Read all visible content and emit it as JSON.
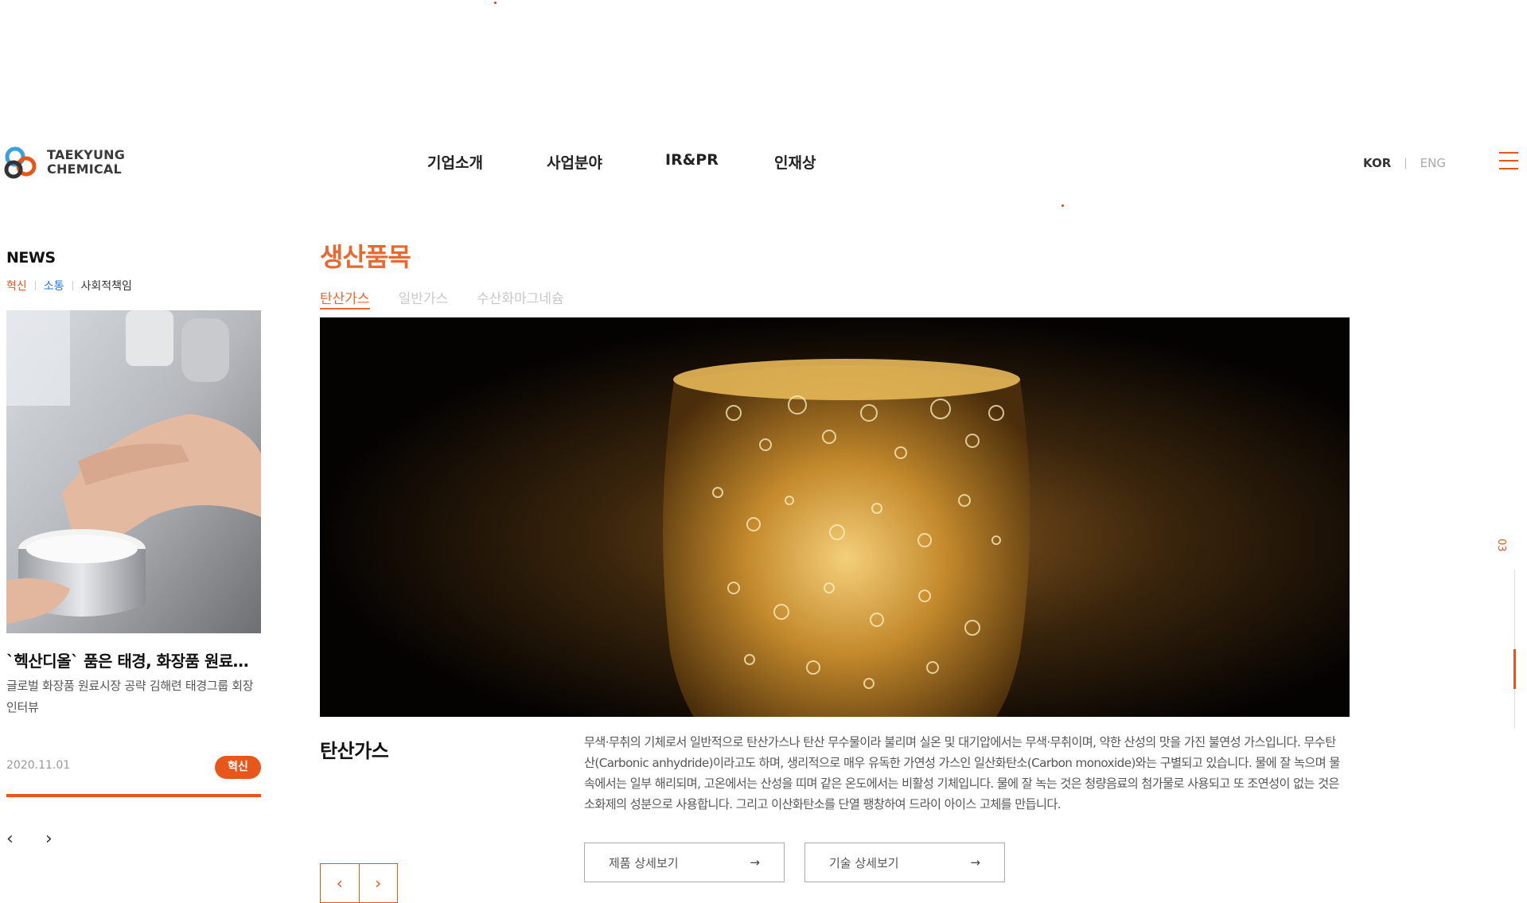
{
  "header": {
    "logo": {
      "line1": "TAEKYUNG",
      "line2": "CHEMICAL"
    },
    "nav": [
      "기업소개",
      "사업분야",
      "IR&PR",
      "인재상"
    ],
    "lang": {
      "kor": "KOR",
      "separator": "|",
      "eng": "ENG"
    },
    "menu_icon": "hamburger-icon"
  },
  "news": {
    "title": "NEWS",
    "tabs": [
      "혁신",
      "소통",
      "사회적책임"
    ],
    "headline": "`헥산디올` 품은 태경, 화장품 원료시장 공략",
    "description": "글로벌 화장품 원료시장 공략 김해련 태경그룹 회장 인터뷰",
    "date": "2020.11.01",
    "badge": "혁신",
    "prev_icon": "chevron-left-icon",
    "next_icon": "chevron-right-icon"
  },
  "products": {
    "title": "생산품목",
    "tabs": [
      "탄산가스",
      "일반가스",
      "수산화마그네슘"
    ],
    "active_tab": "탄산가스",
    "item_name": "탄산가스",
    "description": "무색·무취의 기체로서 일반적으로 탄산가스나 탄산 무수물이라 불리며 실온 및 대기압에서는 무색·무취이며, 약한 산성의 맛을 가진 불연성 가스입니다. 무수탄산(Carbonic anhydride)이라고도 하며, 생리적으로 매우 유독한 가연성 가스인 일산화탄소(Carbon monoxide)와는 구별되고 있습니다. 물에 잘 녹으며 물속에서는 일부 해리되며, 고온에서는 산성을 띠며 같은 온도에서는 비활성 기체입니다. 물에 잘 녹는 것은 청량음료의 첨가물로 사용되고 또 조연성이 없는 것은 소화제의 성분으로 사용합니다. 그리고 이산화탄소를 단열 팽창하여 드라이 아이스 고체를 만듭니다.",
    "buttons": {
      "product_detail": "제품 상세보기",
      "tech_detail": "기술 상세보기"
    }
  },
  "rail": {
    "page": "03"
  },
  "colors": {
    "accent": "#e8561a",
    "title_orange": "#e8682f",
    "link_blue": "#1f7ae0"
  }
}
